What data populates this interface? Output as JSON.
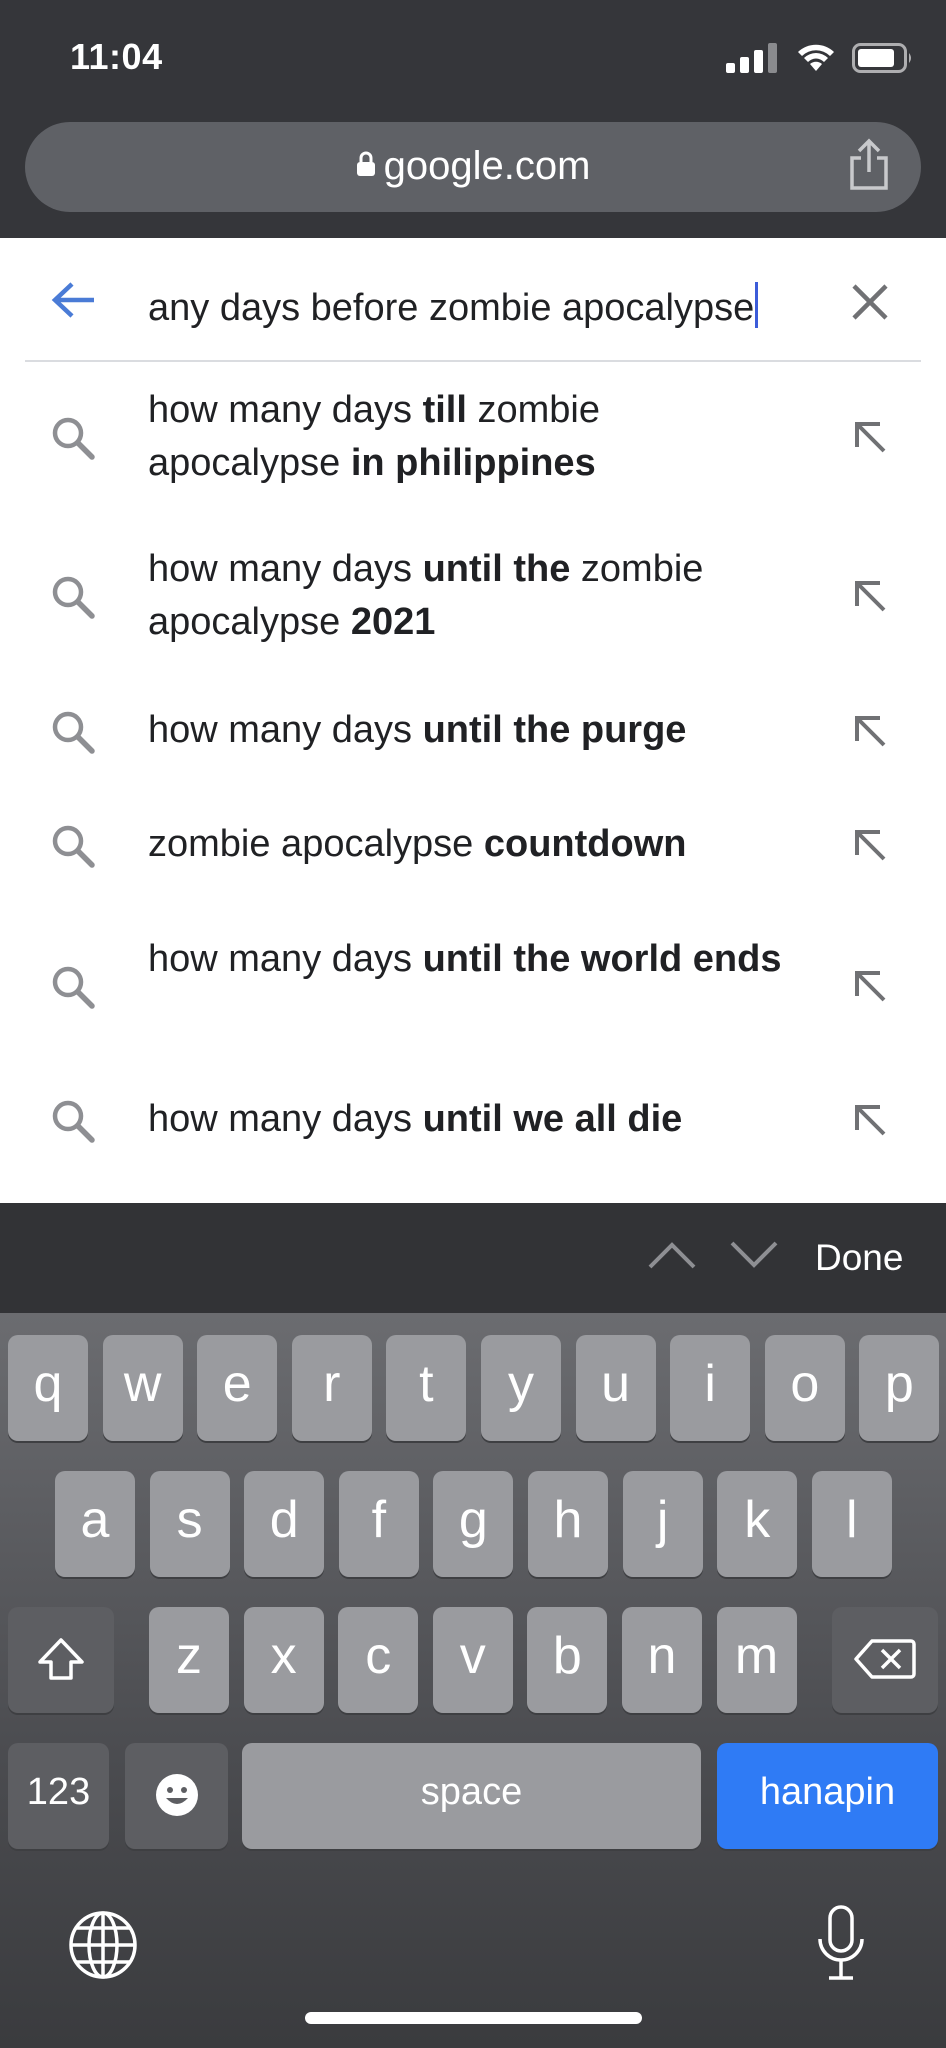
{
  "status": {
    "time": "11:04"
  },
  "url_bar": {
    "domain": "google.com"
  },
  "search": {
    "query": "any days before zombie apocalypse"
  },
  "suggestions": [
    {
      "parts": [
        [
          "how many days ",
          false
        ],
        [
          "till",
          true
        ],
        [
          " zombie apocalypse ",
          false
        ],
        [
          "in philippines",
          true
        ]
      ]
    },
    {
      "parts": [
        [
          "how many days ",
          false
        ],
        [
          "until the",
          true
        ],
        [
          " zombie apocalypse ",
          false
        ],
        [
          "2021",
          true
        ]
      ]
    },
    {
      "parts": [
        [
          "how many days ",
          false
        ],
        [
          "until the purge",
          true
        ]
      ]
    },
    {
      "parts": [
        [
          "zombie apocalypse ",
          false
        ],
        [
          "countdown",
          true
        ]
      ]
    },
    {
      "parts": [
        [
          "how many days ",
          false
        ],
        [
          "until the world ends",
          true
        ]
      ]
    },
    {
      "parts": [
        [
          "how many days ",
          false
        ],
        [
          "until we all die",
          true
        ]
      ]
    }
  ],
  "keyboard_toolbar": {
    "done_label": "Done"
  },
  "keyboard": {
    "row1": [
      "q",
      "w",
      "e",
      "r",
      "t",
      "y",
      "u",
      "i",
      "o",
      "p"
    ],
    "row2": [
      "a",
      "s",
      "d",
      "f",
      "g",
      "h",
      "j",
      "k",
      "l"
    ],
    "row3": [
      "z",
      "x",
      "c",
      "v",
      "b",
      "n",
      "m"
    ],
    "numbers_label": "123",
    "space_label": "space",
    "return_label": "hanapin"
  },
  "colors": {
    "accent_blue": "#2f7bf5",
    "back_arrow": "#4a7bd6",
    "caret": "#3c5cd9"
  }
}
